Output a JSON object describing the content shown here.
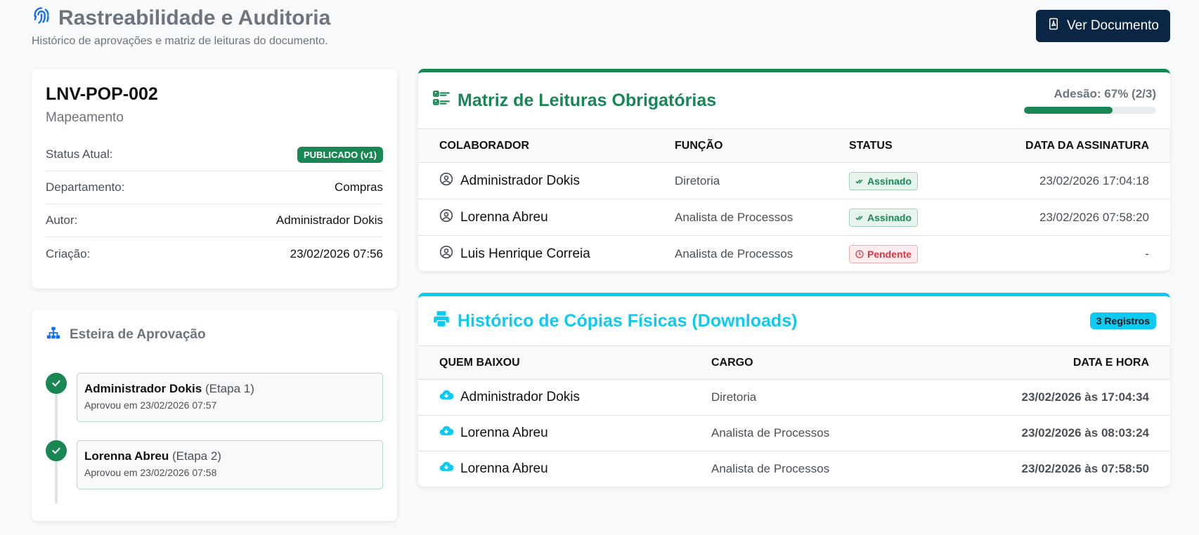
{
  "header": {
    "title": "Rastreabilidade e Auditoria",
    "subtitle": "Histórico de aprovações e matriz de leituras do documento.",
    "view_button": "Ver Documento"
  },
  "document": {
    "code": "LNV-POP-002",
    "name": "Mapeamento",
    "status_label": "Status Atual:",
    "status_value": "PUBLICADO (v1)",
    "department_label": "Departamento:",
    "department_value": "Compras",
    "author_label": "Autor:",
    "author_value": "Administrador Dokis",
    "created_label": "Criação:",
    "created_value": "23/02/2026 07:56"
  },
  "approval": {
    "title": "Esteira de Aprovação",
    "steps": [
      {
        "name": "Administrador Dokis",
        "stage": "(Etapa 1)",
        "date": "Aprovou em 23/02/2026 07:57"
      },
      {
        "name": "Lorenna Abreu",
        "stage": "(Etapa 2)",
        "date": "Aprovou em 23/02/2026 07:58"
      }
    ]
  },
  "matrix": {
    "title": "Matriz de Leituras Obrigatórias",
    "adherence_label": "Adesão: 67% (2/3)",
    "adherence_fraction": 0.67,
    "columns": [
      "COLABORADOR",
      "FUNÇÃO",
      "STATUS",
      "DATA DA ASSINATURA"
    ],
    "rows": [
      {
        "name": "Administrador Dokis",
        "role": "Diretoria",
        "status": "Assinado",
        "date": "23/02/2026 17:04:18"
      },
      {
        "name": "Lorenna Abreu",
        "role": "Analista de Processos",
        "status": "Assinado",
        "date": "23/02/2026 07:58:20"
      },
      {
        "name": "Luis Henrique Correia",
        "role": "Analista de Processos",
        "status": "Pendente",
        "date": "-"
      }
    ]
  },
  "history": {
    "title": "Histórico de Cópias Físicas (Downloads)",
    "count_badge": "3 Registros",
    "columns": [
      "QUEM BAIXOU",
      "CARGO",
      "DATA E HORA"
    ],
    "rows": [
      {
        "name": "Administrador Dokis",
        "role": "Diretoria",
        "date": "23/02/2026 às 17:04:34"
      },
      {
        "name": "Lorenna Abreu",
        "role": "Analista de Processos",
        "date": "23/02/2026 às 08:03:24"
      },
      {
        "name": "Lorenna Abreu",
        "role": "Analista de Processos",
        "date": "23/02/2026 às 07:58:50"
      }
    ]
  },
  "colors": {
    "success": "#198754",
    "info": "#0dcaf0",
    "danger": "#dc3545",
    "primary_dark": "#0b2545",
    "accent_blue": "#0d6efd"
  },
  "icons": {
    "title": "fingerprint-icon",
    "view_button": "file-pdf-icon",
    "approval": "sitemap-icon",
    "matrix": "list-check-icon",
    "history": "printer-icon",
    "person": "user-circle-icon",
    "download": "cloud-download-icon"
  }
}
